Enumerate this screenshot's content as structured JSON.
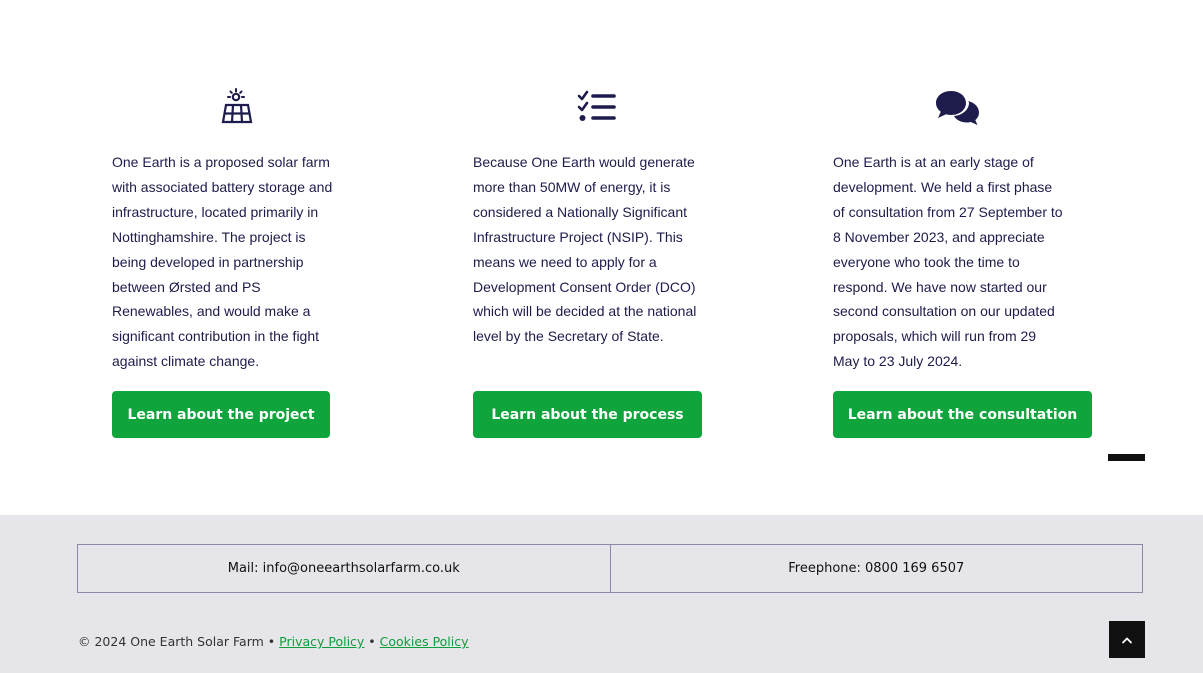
{
  "features": [
    {
      "icon": "solar-panel-icon",
      "text": "One Earth is a proposed solar farm with associated battery storage and infrastructure, located primarily in Nottinghamshire. The project is being developed in partnership between Ørsted and PS Renewables, and would make a significant contribution in the fight against climate change.",
      "button_label": "Learn about the project"
    },
    {
      "icon": "checklist-icon",
      "text": "Because One Earth would generate more than 50MW of energy, it is considered a Nationally Significant Infrastructure Project (NSIP). This means we need to apply for a Development Consent Order (DCO) which will be decided at the national level by the Secretary of State.",
      "button_label": "Learn about the process"
    },
    {
      "icon": "chat-bubbles-icon",
      "text": "One Earth is at an early stage of development. We held a first phase of consultation from 27 September to 8 November 2023, and appreciate everyone who took the time to respond. We have now started our second consultation on our updated proposals, which will run from 29 May to 23 July 2024.",
      "button_label": "Learn about the consultation"
    }
  ],
  "footer": {
    "mail": "Mail: info@oneearthsolarfarm.co.uk",
    "phone": "Freephone: 0800 169 6507",
    "copyright": "© 2024 One Earth Solar Farm",
    "separator": " • ",
    "privacy_link": "Privacy Policy",
    "cookies_link": "Cookies Policy",
    "back_to_top_icon": "chevron-up-icon"
  },
  "colors": {
    "accent_green": "#0fa43c",
    "text_navy": "#1d1c4c",
    "footer_bg": "#e6e6ea"
  }
}
